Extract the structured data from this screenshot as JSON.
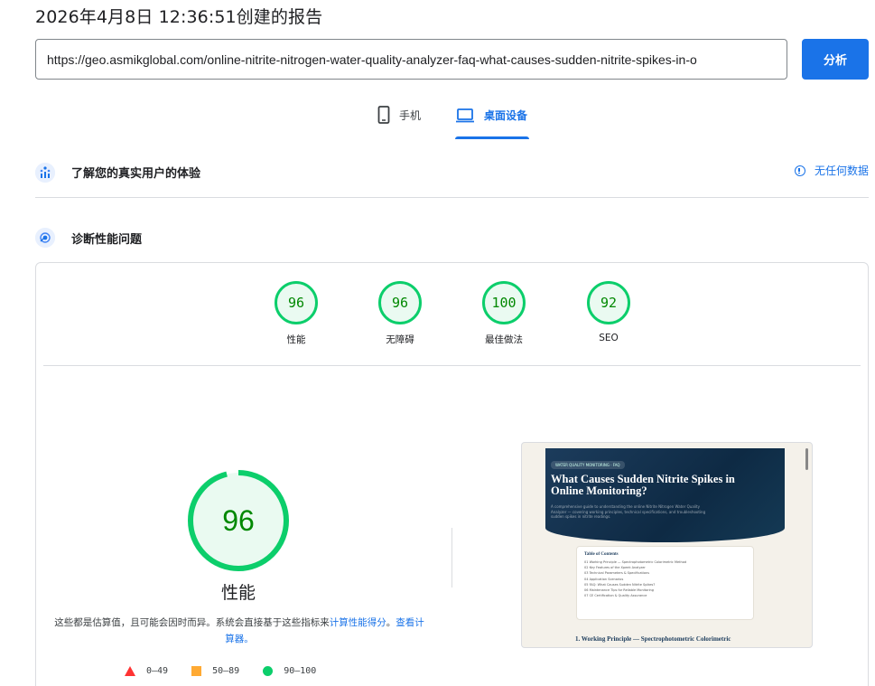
{
  "report": {
    "title": "2026年4月8日 12:36:51创建的报告"
  },
  "url_input": {
    "value": "https://geo.asmikglobal.com/online-nitrite-nitrogen-water-quality-analyzer-faq-what-causes-sudden-nitrite-spikes-in-o"
  },
  "analyze_button": {
    "label": "分析"
  },
  "device_tabs": [
    {
      "label": "手机",
      "icon": "phone-icon",
      "selected": false
    },
    {
      "label": "桌面设备",
      "icon": "laptop-icon",
      "selected": true
    }
  ],
  "crux_section": {
    "title": "了解您的真实用户的体验",
    "no_data_label": "无任何数据",
    "icon": "crux-icon"
  },
  "diagnose_section": {
    "title": "诊断性能问题",
    "icon": "lighthouse-icon"
  },
  "category_gauges": [
    {
      "score": "96",
      "label": "性能"
    },
    {
      "score": "96",
      "label": "无障碍"
    },
    {
      "score": "100",
      "label": "最佳做法"
    },
    {
      "score": "92",
      "label": "SEO"
    }
  ],
  "performance": {
    "score": "96",
    "score_fraction": 0.96,
    "label": "性能",
    "description_text": "这些都是估算值，且可能会因时而异。系统会直接基于这些指标来",
    "description_link1": "计算性能得分",
    "description_sep": "。",
    "description_link2": "查看计算器。"
  },
  "legend": [
    {
      "range": "0–49",
      "shape": "triangle",
      "color": "#ff3333"
    },
    {
      "range": "50–89",
      "shape": "square",
      "color": "#ffaa33"
    },
    {
      "range": "90–100",
      "shape": "circle",
      "color": "#0cce6b"
    }
  ],
  "page_screenshot": {
    "badge": "WATER QUALITY MONITORING · FAQ",
    "title": "What Causes Sudden Nitrite Spikes in Online Monitoring?",
    "subtitle": "A comprehensive guide to understanding the online Nitrite Nitrogen Water Quality Analyzer — covering working principles, technical specifications, and troubleshooting sudden spikes in nitrite readings.",
    "toc_title": "Table of Contents",
    "toc_items": [
      "01 Working Principle — Spectrophotometric Colorimetric Method",
      "02 Key Features of the Xpeek Analyzer",
      "03 Technical Parameters & Specifications",
      "04 Application Scenarios",
      "05 FAQ: What Causes Sudden Nitrite Spikes?",
      "06 Maintenance Tips for Reliable Monitoring",
      "07 CE Certification & Quality Assurance"
    ],
    "first_heading": "1. Working Principle — Spectrophotometric Colorimetric"
  },
  "colors": {
    "accent": "#1a73e8",
    "pass_green": "#0cce6b",
    "pass_text": "#008800",
    "pass_fill": "#eafaf1"
  }
}
